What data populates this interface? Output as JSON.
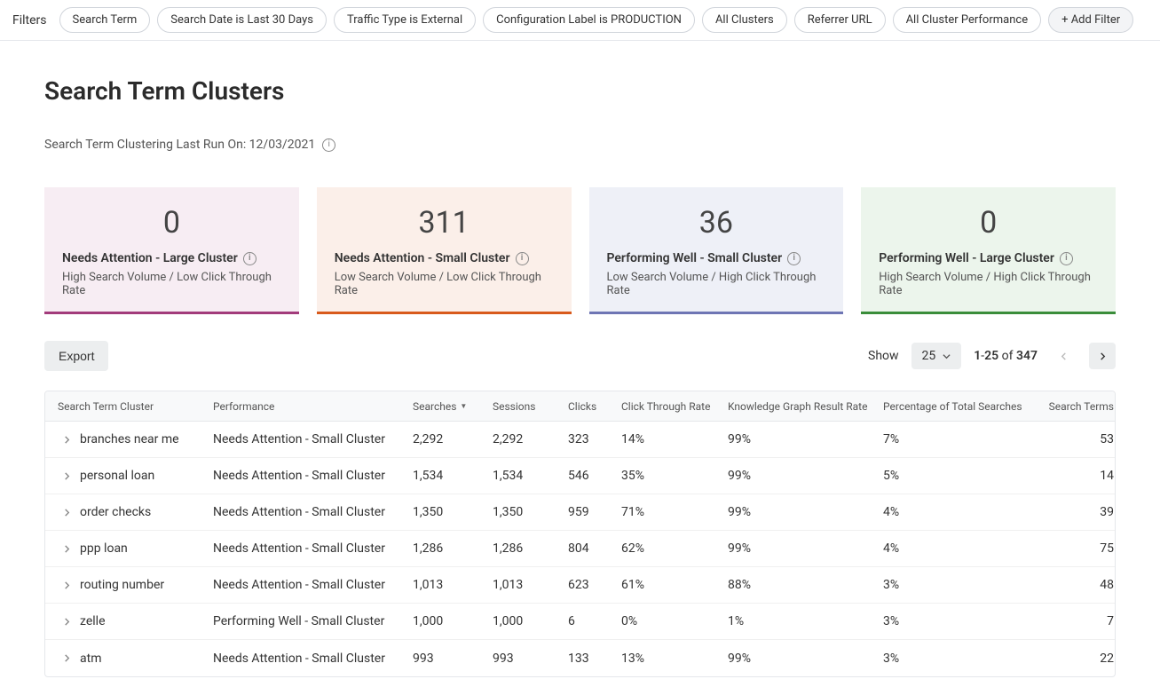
{
  "filters": {
    "label": "Filters",
    "pills": [
      "Search Term",
      "Search Date is Last 30 Days",
      "Traffic Type is External",
      "Configuration Label is PRODUCTION",
      "All Clusters",
      "Referrer URL",
      "All Cluster Performance"
    ],
    "add_label": "+ Add Filter"
  },
  "page_title": "Search Term Clusters",
  "last_run_label": "Search Term Clustering Last Run On: 12/03/2021",
  "cards": [
    {
      "count": "0",
      "title": "Needs Attention - Large Cluster",
      "sub": "High Search Volume / Low Click Through Rate",
      "style": "pink"
    },
    {
      "count": "311",
      "title": "Needs Attention - Small Cluster",
      "sub": "Low Search Volume / Low Click Through Rate",
      "style": "orange"
    },
    {
      "count": "36",
      "title": "Performing Well - Small Cluster",
      "sub": "Low Search Volume / High Click Through Rate",
      "style": "blue"
    },
    {
      "count": "0",
      "title": "Performing Well - Large Cluster",
      "sub": "High Search Volume / High Click Through Rate",
      "style": "green"
    }
  ],
  "toolbar": {
    "export_label": "Export",
    "show_label": "Show",
    "page_size": "25",
    "range_from": "1",
    "range_to": "25",
    "range_of": "of",
    "range_total": "347"
  },
  "columns": {
    "c0": "Search Term Cluster",
    "c1": "Performance",
    "c2": "Searches",
    "c3": "Sessions",
    "c4": "Clicks",
    "c5": "Click Through Rate",
    "c6": "Knowledge Graph Result Rate",
    "c7": "Percentage of Total Searches",
    "c8": "Search Terms"
  },
  "rows": [
    {
      "name": "branches near me",
      "perf": "Needs Attention - Small Cluster",
      "searches": "2,292",
      "sessions": "2,292",
      "clicks": "323",
      "ctr": "14%",
      "kg": "99%",
      "pts": "7%",
      "terms": "53"
    },
    {
      "name": "personal loan",
      "perf": "Needs Attention - Small Cluster",
      "searches": "1,534",
      "sessions": "1,534",
      "clicks": "546",
      "ctr": "35%",
      "kg": "99%",
      "pts": "5%",
      "terms": "14"
    },
    {
      "name": "order checks",
      "perf": "Needs Attention - Small Cluster",
      "searches": "1,350",
      "sessions": "1,350",
      "clicks": "959",
      "ctr": "71%",
      "kg": "99%",
      "pts": "4%",
      "terms": "39"
    },
    {
      "name": "ppp loan",
      "perf": "Needs Attention - Small Cluster",
      "searches": "1,286",
      "sessions": "1,286",
      "clicks": "804",
      "ctr": "62%",
      "kg": "99%",
      "pts": "4%",
      "terms": "75"
    },
    {
      "name": "routing number",
      "perf": "Needs Attention - Small Cluster",
      "searches": "1,013",
      "sessions": "1,013",
      "clicks": "623",
      "ctr": "61%",
      "kg": "88%",
      "pts": "3%",
      "terms": "48"
    },
    {
      "name": "zelle",
      "perf": "Performing Well - Small Cluster",
      "searches": "1,000",
      "sessions": "1,000",
      "clicks": "6",
      "ctr": "0%",
      "kg": "1%",
      "pts": "3%",
      "terms": "7"
    },
    {
      "name": "atm",
      "perf": "Needs Attention - Small Cluster",
      "searches": "993",
      "sessions": "993",
      "clicks": "133",
      "ctr": "13%",
      "kg": "99%",
      "pts": "3%",
      "terms": "22"
    }
  ]
}
